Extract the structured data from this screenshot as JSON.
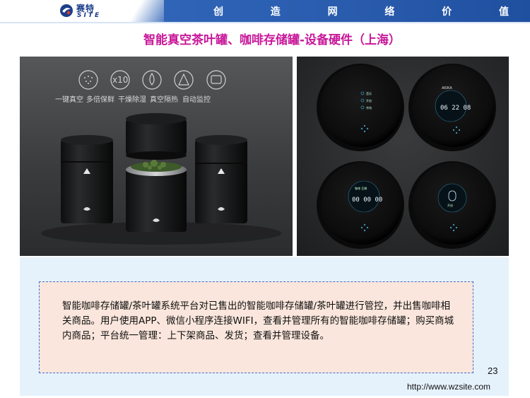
{
  "header": {
    "logo_cn": "赛特",
    "logo_en": "SITE",
    "slogan": [
      "创",
      "造",
      "网",
      "络",
      "价",
      "值"
    ],
    "colors": {
      "bar": "#2f64b6",
      "logo": "#1c3f8a"
    }
  },
  "title": "智能真空茶叶罐、咖啡存储罐-设备硬件（上海）",
  "left_photo": {
    "features": [
      "一键真空",
      "多倍保鲜",
      "干燥除湿",
      "真空隔热",
      "自动监控"
    ],
    "x10_label": "x10"
  },
  "right_photo": {
    "menu_items": [
      "音乐",
      "开启",
      "充电"
    ],
    "brand_text": "AKIKA",
    "clock_time": "06 22 08",
    "timer_label": "咖啡 豆剩",
    "timer_value": "00 00 00",
    "alert_label": "开启"
  },
  "description": "智能咖啡存储罐/茶叶罐系统平台对已售出的智能咖啡存储罐/茶叶罐进行管控，并出售咖啡相关商品。用户使用APP、微信小程序连接WIFI，查看并管理所有的智能咖啡存储罐；购买商城内商品；平台统一管理：上下架商品、发货；查看并管理设备。",
  "page_number": "23",
  "site_url": "http://www.wzsite.com",
  "colors": {
    "title": "#c8189a",
    "panel": "#e6f2fb",
    "box": "#fae6dc",
    "box_border": "#3e6fd0"
  }
}
